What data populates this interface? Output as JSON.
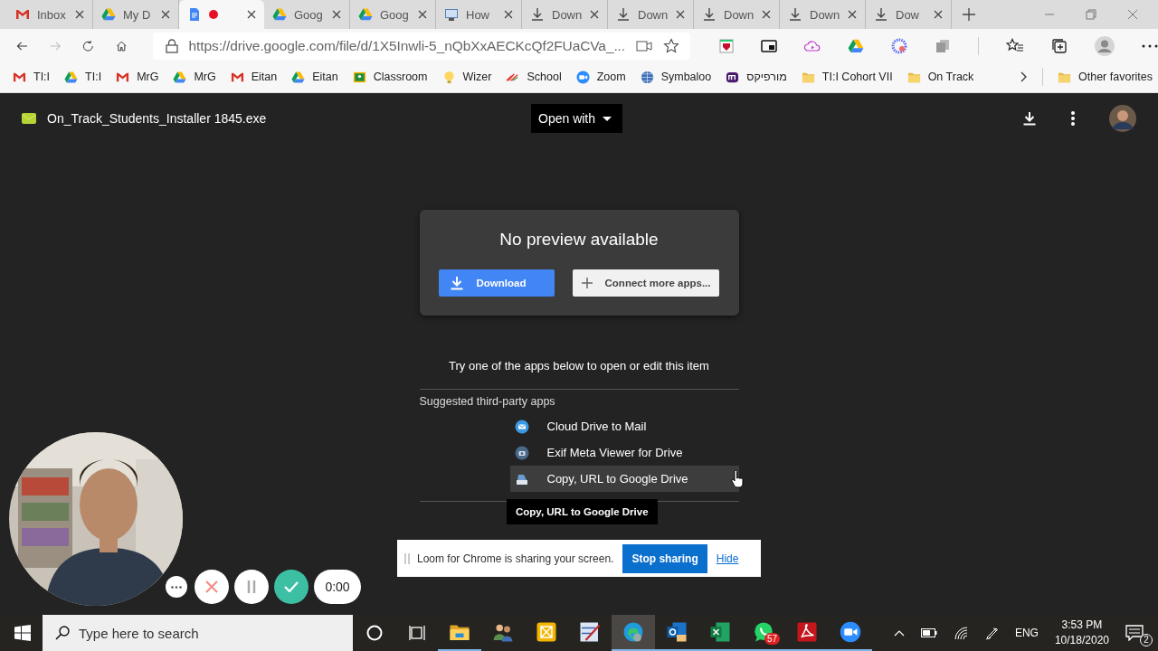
{
  "browser": {
    "tabs": [
      {
        "title": "Inbox",
        "kind": "gmail",
        "recording": false,
        "selected": false
      },
      {
        "title": "My D",
        "kind": "drive",
        "recording": false,
        "selected": false
      },
      {
        "kind": "doc",
        "recording": true,
        "selected": true
      },
      {
        "title": "Goog",
        "kind": "drive",
        "recording": false,
        "selected": false
      },
      {
        "title": "Goog",
        "kind": "drive",
        "recording": false,
        "selected": false
      },
      {
        "title": "How",
        "kind": "screen",
        "recording": false,
        "selected": false
      },
      {
        "title": "Down",
        "kind": "download",
        "recording": false,
        "selected": false
      },
      {
        "title": "Down",
        "kind": "download",
        "recording": false,
        "selected": false
      },
      {
        "title": "Down",
        "kind": "download",
        "recording": false,
        "selected": false
      },
      {
        "title": "Down",
        "kind": "download",
        "recording": false,
        "selected": false
      },
      {
        "title": "Dow",
        "kind": "download",
        "recording": false,
        "selected": false
      }
    ],
    "url": "https://drive.google.com/file/d/1X5Inwli-5_nQbXxAECKcQf2FUaCVa_...",
    "bookmarks": [
      {
        "label": "TI:I",
        "kind": "gmail"
      },
      {
        "label": "TI:I",
        "kind": "drive"
      },
      {
        "label": "MrG",
        "kind": "gmail"
      },
      {
        "label": "MrG",
        "kind": "drive"
      },
      {
        "label": "Eitan",
        "kind": "gmail"
      },
      {
        "label": "Eitan",
        "kind": "drive"
      },
      {
        "label": "Classroom",
        "kind": "classroom"
      },
      {
        "label": "Wizer",
        "kind": "bulb"
      },
      {
        "label": "School",
        "kind": "school"
      },
      {
        "label": "Zoom",
        "kind": "zoom"
      },
      {
        "label": "Symbaloo",
        "kind": "globe"
      },
      {
        "label": "מורפיקס",
        "kind": "morfix"
      },
      {
        "label": "TI:I Cohort VII",
        "kind": "folder"
      },
      {
        "label": "On Track",
        "kind": "folder"
      }
    ],
    "other_favorites": "Other favorites"
  },
  "viewer": {
    "file_name": "On_Track_Students_Installer 1845.exe",
    "open_with": "Open with",
    "preview": {
      "title": "No preview available",
      "download": "Download",
      "connect": "Connect more apps..."
    },
    "hint": "Try one of the apps below to open or edit this item",
    "suggested_heading": "Suggested third-party apps",
    "apps": [
      {
        "name": "Cloud Drive to Mail",
        "kind": "mail",
        "highlighted": false
      },
      {
        "name": "Exif Meta Viewer for Drive",
        "kind": "camera",
        "highlighted": false
      },
      {
        "name": "Copy, URL to Google Drive",
        "kind": "tray",
        "highlighted": true
      }
    ],
    "tooltip": "Copy, URL to Google Drive"
  },
  "loom": {
    "message": "Loom for Chrome is sharing your screen.",
    "stop": "Stop sharing",
    "hide": "Hide",
    "timer": "0:00"
  },
  "taskbar": {
    "search_placeholder": "Type here to search",
    "apps": [
      {
        "kind": "explorer",
        "running": true,
        "selected": false
      },
      {
        "kind": "people",
        "running": false,
        "selected": false
      },
      {
        "kind": "slides",
        "running": false,
        "selected": false
      },
      {
        "kind": "paint",
        "running": false,
        "selected": false
      },
      {
        "kind": "edge",
        "running": true,
        "selected": true
      },
      {
        "kind": "outlook",
        "running": true,
        "selected": false
      },
      {
        "kind": "excel",
        "running": true,
        "selected": false
      },
      {
        "kind": "whatsapp",
        "running": true,
        "selected": false,
        "badge": "57"
      },
      {
        "kind": "acrobat",
        "running": true,
        "selected": false
      },
      {
        "kind": "zoom",
        "running": true,
        "selected": false
      }
    ],
    "language": "ENG",
    "time": "3:53 PM",
    "date": "10/18/2020",
    "notifications": "2"
  }
}
